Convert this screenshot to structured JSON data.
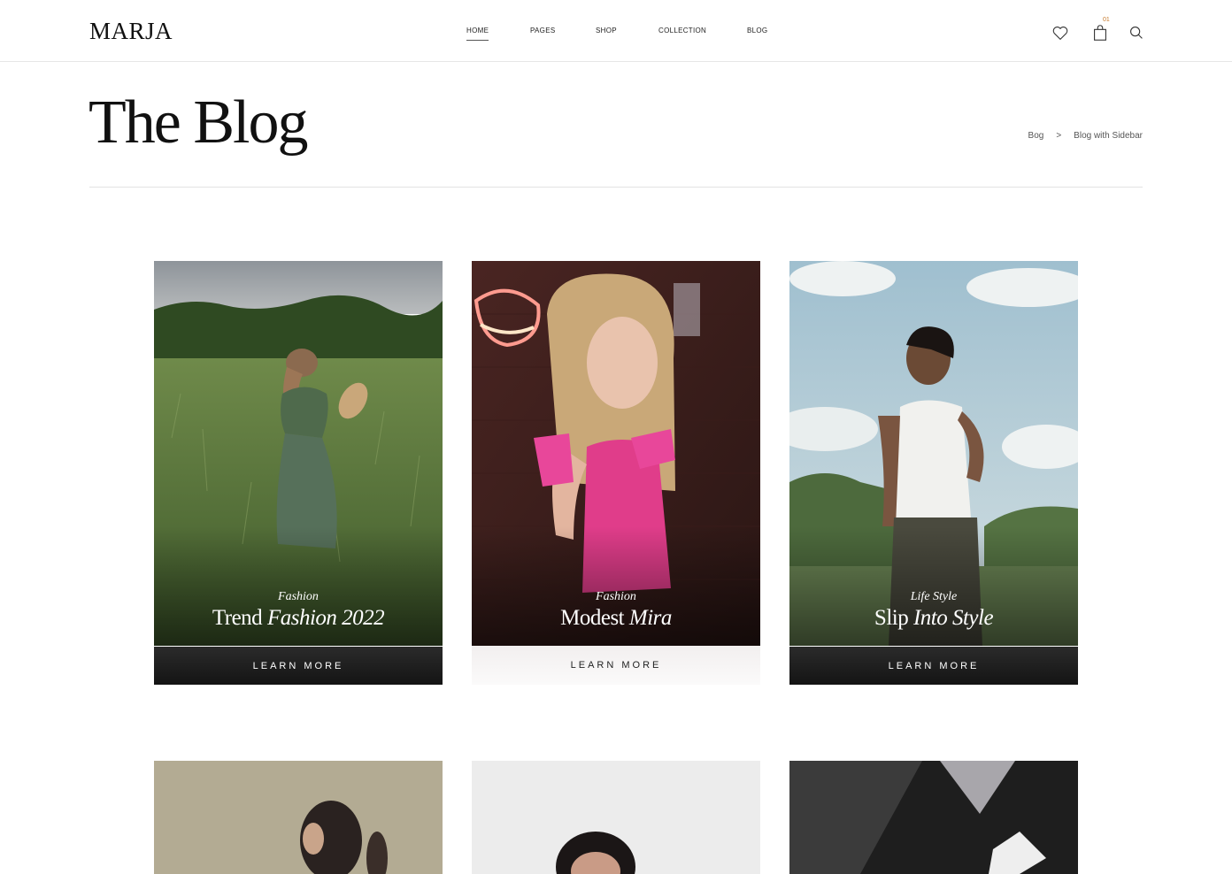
{
  "brand": {
    "logo": "MARJA"
  },
  "nav": {
    "items": [
      {
        "label": "HOME",
        "active": true
      },
      {
        "label": "PAGES"
      },
      {
        "label": "SHOP"
      },
      {
        "label": "COLLECTION"
      },
      {
        "label": "BLOG"
      }
    ]
  },
  "header_icons": {
    "wishlist": "heart-icon",
    "cart": "shopping-bag-icon",
    "cart_count": "01",
    "search": "search-icon"
  },
  "page": {
    "title": "The Blog",
    "breadcrumb": [
      "Bog",
      ">",
      "Blog with Sidebar"
    ]
  },
  "posts": [
    {
      "category": "Fashion",
      "title_plain": "Trend ",
      "title_italic": "Fashion 2022",
      "button": "LEARN MORE",
      "button_style": "dark"
    },
    {
      "category": "Fashion",
      "title_plain": "Modest ",
      "title_italic": "Mira",
      "button": "LEARN MORE",
      "button_style": "light"
    },
    {
      "category": "Life Style",
      "title_plain": "Slip ",
      "title_italic": "Into Style",
      "button": "LEARN MORE",
      "button_style": "dark"
    }
  ],
  "colors": {
    "accent": "#c77b2e",
    "text": "#1a1a1a",
    "divider": "#e3e3e3"
  }
}
